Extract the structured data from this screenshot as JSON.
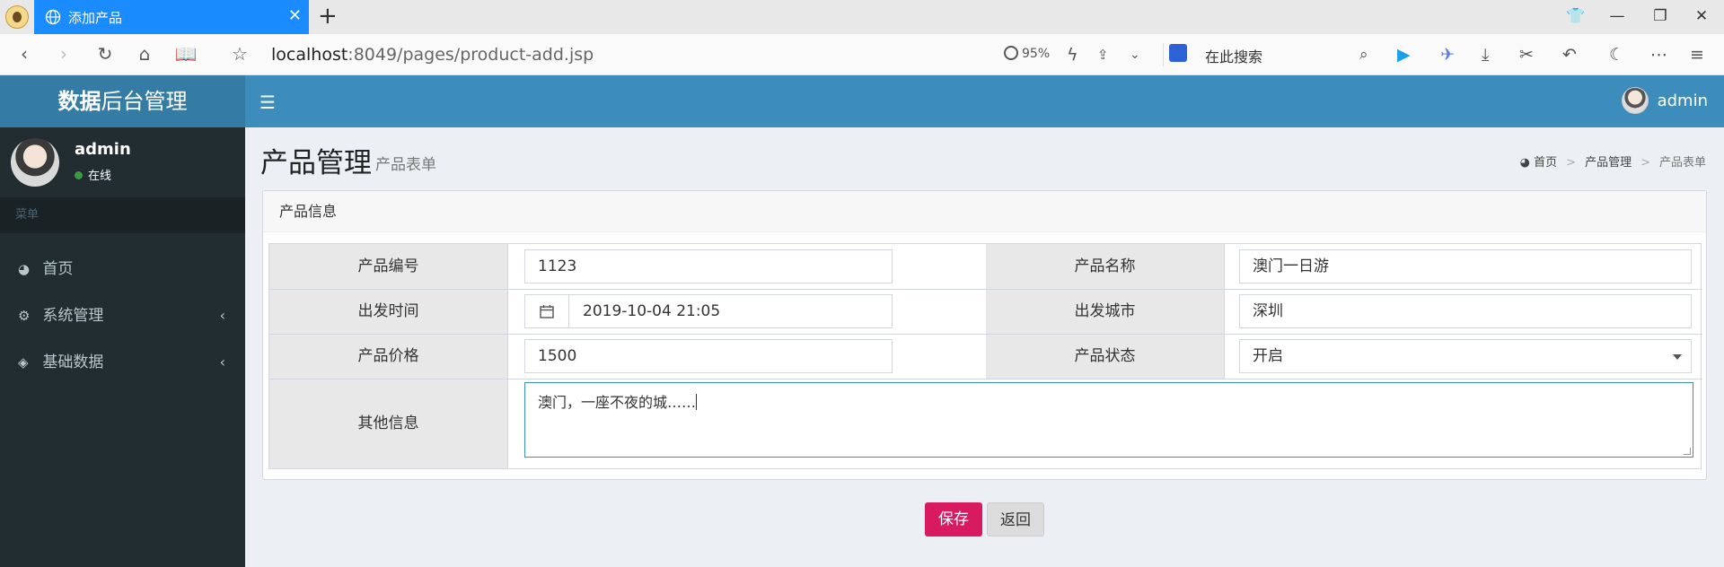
{
  "browser": {
    "tab_title": "添加产品",
    "url_host": "localhost",
    "url_rest": ":8049/pages/product-add.jsp",
    "zoom": "95%",
    "search_placeholder": "在此搜索"
  },
  "header": {
    "brand_bold": "数据",
    "brand_rest": "后台管理",
    "user": "admin"
  },
  "sidebar": {
    "user_name": "admin",
    "status": "在线",
    "menu_header": "菜单",
    "items": [
      {
        "label": "首页"
      },
      {
        "label": "系统管理"
      },
      {
        "label": "基础数据"
      }
    ]
  },
  "page": {
    "title": "产品管理",
    "subtitle": "产品表单",
    "breadcrumb": [
      "首页",
      "产品管理",
      "产品表单"
    ]
  },
  "form": {
    "box_title": "产品信息",
    "fields": {
      "product_num_label": "产品编号",
      "product_num": "1123",
      "product_name_label": "产品名称",
      "product_name": "澳门一日游",
      "depart_time_label": "出发时间",
      "depart_time": "2019-10-04 21:05",
      "city_label": "出发城市",
      "city": "深圳",
      "price_label": "产品价格",
      "price": "1500",
      "status_label": "产品状态",
      "status": "开启",
      "desc_label": "其他信息",
      "desc": "澳门，一座不夜的城……"
    },
    "save_label": "保存",
    "back_label": "返回"
  },
  "colors": {
    "tab_active": "#1a8cff",
    "brand": "#357ca5",
    "topnav": "#3c8dbc",
    "sidebar": "#222d32",
    "save_button": "#d81b60"
  }
}
